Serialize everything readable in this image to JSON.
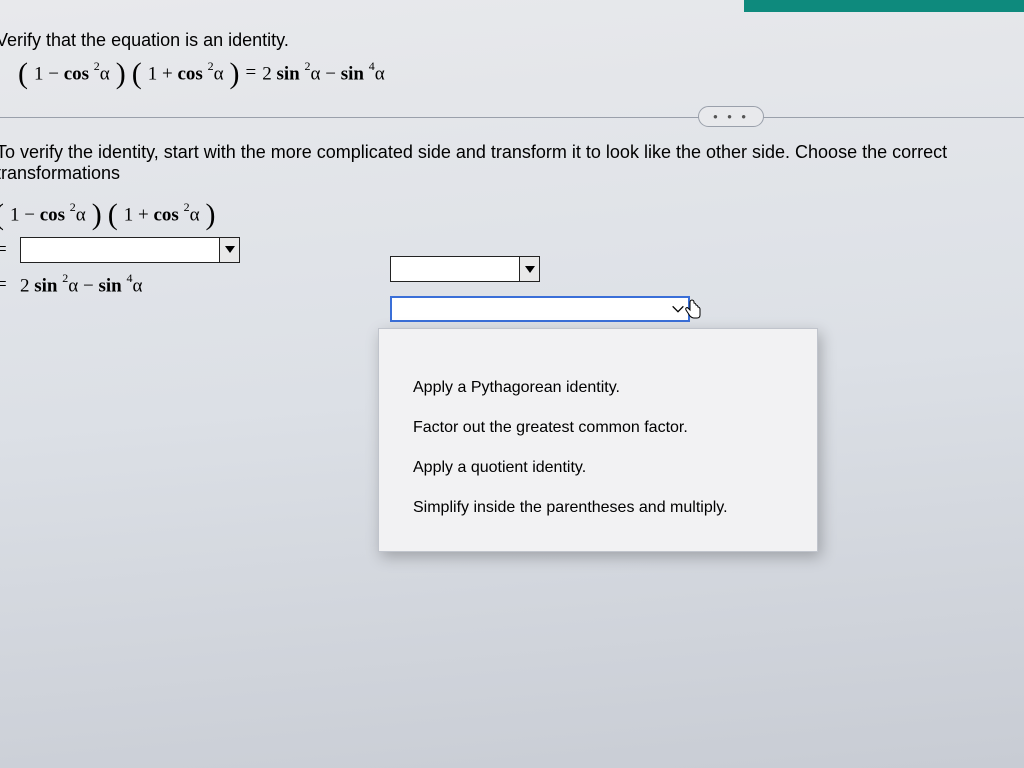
{
  "header": {
    "title": "Verify that the equation is an identity."
  },
  "equation": {
    "lhs_p1_a": "1 −",
    "lhs_p1_fn": "cos",
    "lhs_p1_sup": "2",
    "lhs_p1_var": "α",
    "lhs_p2_a": "1 +",
    "lhs_p2_fn": "cos",
    "lhs_p2_sup": "2",
    "lhs_p2_var": "α",
    "eq": "=",
    "rhs_a": "2",
    "rhs_fn1": "sin",
    "rhs_sup1": "2",
    "rhs_var1": "α",
    "rhs_minus": "−",
    "rhs_fn2": "sin",
    "rhs_sup2": "4",
    "rhs_var2": "α"
  },
  "dots": "• • •",
  "instruction": "To verify the identity, start with the more complicated side and transform it to look like the other side. Choose the correct transformations",
  "work": {
    "l1_p1_a": "1 −",
    "l1_p1_fn": "cos",
    "l1_p1_sup": "2",
    "l1_p1_var": "α",
    "l1_p2_a": "1 +",
    "l1_p2_fn": "cos",
    "l1_p2_sup": "2",
    "l1_p2_var": "α",
    "eq1": "=",
    "eq2": "=",
    "l3_a": "2",
    "l3_fn1": "sin",
    "l3_sup1": "2",
    "l3_var1": "α",
    "l3_minus": "−",
    "l3_fn2": "sin",
    "l3_sup2": "4",
    "l3_var2": "α"
  },
  "dropdown": {
    "options": [
      "Apply a Pythagorean identity.",
      "Factor out the greatest common factor.",
      "Apply a quotient identity.",
      "Simplify inside the parentheses and multiply."
    ]
  }
}
